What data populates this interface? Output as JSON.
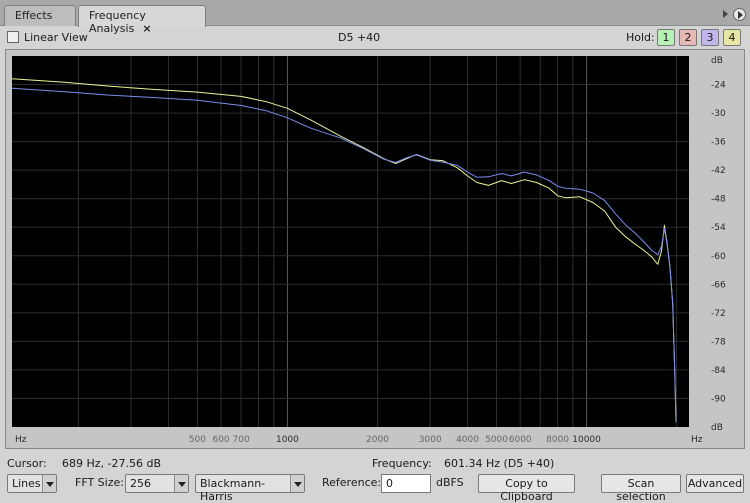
{
  "tabs": [
    {
      "label": "Effects"
    },
    {
      "label": "Frequency Analysis",
      "close": "×"
    }
  ],
  "toolbar": {
    "linear_view_label": "Linear View",
    "linear_view_checked": false,
    "center_label": "D5 +40",
    "hold_label": "Hold:",
    "hold_buttons": [
      {
        "label": "1",
        "color": "#b6f2b6"
      },
      {
        "label": "2",
        "color": "#e8b8b8"
      },
      {
        "label": "3",
        "color": "#c2b6ec"
      },
      {
        "label": "4",
        "color": "#e6e6a6"
      }
    ]
  },
  "chart_data": {
    "type": "line",
    "x_scale": "log",
    "xlim": [
      120,
      22000
    ],
    "ylim": [
      -96,
      -18
    ],
    "grid": true,
    "x_unit_label_left": "Hz",
    "x_unit_label_right": "Hz",
    "y_unit_label_top": "dB",
    "y_unit_label_bottom": "dB",
    "x_ticks": [
      {
        "value": 500,
        "label": "500",
        "major": false
      },
      {
        "value": 600,
        "label": "600",
        "major": false
      },
      {
        "value": 700,
        "label": "700",
        "major": false
      },
      {
        "value": 1000,
        "label": "1000",
        "major": true
      },
      {
        "value": 2000,
        "label": "2000",
        "major": false
      },
      {
        "value": 3000,
        "label": "3000",
        "major": false
      },
      {
        "value": 4000,
        "label": "4000",
        "major": false
      },
      {
        "value": 5000,
        "label": "5000",
        "major": false
      },
      {
        "value": 6000,
        "label": "6000",
        "major": false
      },
      {
        "value": 8000,
        "label": "8000",
        "major": false
      },
      {
        "value": 10000,
        "label": "10000",
        "major": true
      }
    ],
    "x_minor_gridlines": [
      200,
      300,
      400,
      800,
      900,
      7000,
      9000,
      20000
    ],
    "y_ticks": [
      -24,
      -30,
      -36,
      -42,
      -48,
      -54,
      -60,
      -66,
      -72,
      -78,
      -84,
      -90
    ],
    "series": [
      {
        "color": "#e9f59a",
        "points": [
          [
            120,
            -22.8
          ],
          [
            180,
            -23.5
          ],
          [
            250,
            -24.3
          ],
          [
            350,
            -25
          ],
          [
            500,
            -25.6
          ],
          [
            700,
            -26.5
          ],
          [
            850,
            -27.6
          ],
          [
            1000,
            -29
          ],
          [
            1200,
            -31.5
          ],
          [
            1500,
            -34.8
          ],
          [
            1800,
            -37.3
          ],
          [
            2100,
            -39.6
          ],
          [
            2300,
            -40.6
          ],
          [
            2500,
            -39.6
          ],
          [
            2700,
            -38.7
          ],
          [
            3000,
            -39.8
          ],
          [
            3300,
            -40
          ],
          [
            3700,
            -41.5
          ],
          [
            4000,
            -43.2
          ],
          [
            4300,
            -44.6
          ],
          [
            4700,
            -45.2
          ],
          [
            5200,
            -44.2
          ],
          [
            5600,
            -44.8
          ],
          [
            6200,
            -44
          ],
          [
            6800,
            -44.6
          ],
          [
            7500,
            -45.8
          ],
          [
            8000,
            -47.4
          ],
          [
            8500,
            -47.8
          ],
          [
            9500,
            -47.6
          ],
          [
            10500,
            -48.8
          ],
          [
            11500,
            -50.6
          ],
          [
            12500,
            -54
          ],
          [
            13500,
            -56
          ],
          [
            14500,
            -57.5
          ],
          [
            15500,
            -58.8
          ],
          [
            16500,
            -60.2
          ],
          [
            17300,
            -61.8
          ],
          [
            17800,
            -59
          ],
          [
            18200,
            -53.6
          ],
          [
            18600,
            -57.5
          ],
          [
            19000,
            -62.5
          ],
          [
            19400,
            -70
          ],
          [
            19700,
            -84
          ],
          [
            19900,
            -95
          ]
        ]
      },
      {
        "color": "#7b8cec",
        "points": [
          [
            120,
            -24.8
          ],
          [
            180,
            -25.5
          ],
          [
            250,
            -26.2
          ],
          [
            350,
            -26.7
          ],
          [
            500,
            -27.3
          ],
          [
            700,
            -28.4
          ],
          [
            850,
            -29.5
          ],
          [
            1000,
            -31
          ],
          [
            1200,
            -33.2
          ],
          [
            1500,
            -35.2
          ],
          [
            1800,
            -37.5
          ],
          [
            2100,
            -39.7
          ],
          [
            2300,
            -40.4
          ],
          [
            2500,
            -39.4
          ],
          [
            2700,
            -38.8
          ],
          [
            3000,
            -39.9
          ],
          [
            3300,
            -40.3
          ],
          [
            3700,
            -41
          ],
          [
            4000,
            -42.4
          ],
          [
            4300,
            -43.5
          ],
          [
            4700,
            -43.4
          ],
          [
            5200,
            -42.7
          ],
          [
            5600,
            -43.2
          ],
          [
            6200,
            -42.4
          ],
          [
            6800,
            -43
          ],
          [
            7500,
            -44.2
          ],
          [
            8000,
            -45.4
          ],
          [
            8500,
            -45.8
          ],
          [
            9500,
            -46
          ],
          [
            10500,
            -46.8
          ],
          [
            11500,
            -48.4
          ],
          [
            12500,
            -51.2
          ],
          [
            13500,
            -53.5
          ],
          [
            14500,
            -55.2
          ],
          [
            15500,
            -57
          ],
          [
            16500,
            -58.8
          ],
          [
            17300,
            -59.8
          ],
          [
            17800,
            -58
          ],
          [
            18200,
            -54.2
          ],
          [
            18600,
            -57.8
          ],
          [
            19000,
            -62.5
          ],
          [
            19400,
            -70
          ],
          [
            19700,
            -84
          ],
          [
            19900,
            -95
          ]
        ]
      }
    ]
  },
  "status": {
    "cursor_label": "Cursor:",
    "cursor_value": "689 Hz, -27.56 dB",
    "frequency_label": "Frequency:",
    "frequency_value": "601.34 Hz (D5 +40)"
  },
  "controls": {
    "plot_mode": "Lines",
    "fft_label": "FFT Size:",
    "fft_value": "256",
    "window_value": "Blackmann-Harris",
    "reference_label": "Reference:",
    "reference_value": "0",
    "reference_unit": "dBFS",
    "copy_label": "Copy to Clipboard",
    "scan_label": "Scan selection",
    "advanced_label": "Advanced"
  },
  "colors": {
    "plot_background": "#000000",
    "grid_major": "#5a5a5a",
    "grid_minor": "#2e2e2e"
  }
}
